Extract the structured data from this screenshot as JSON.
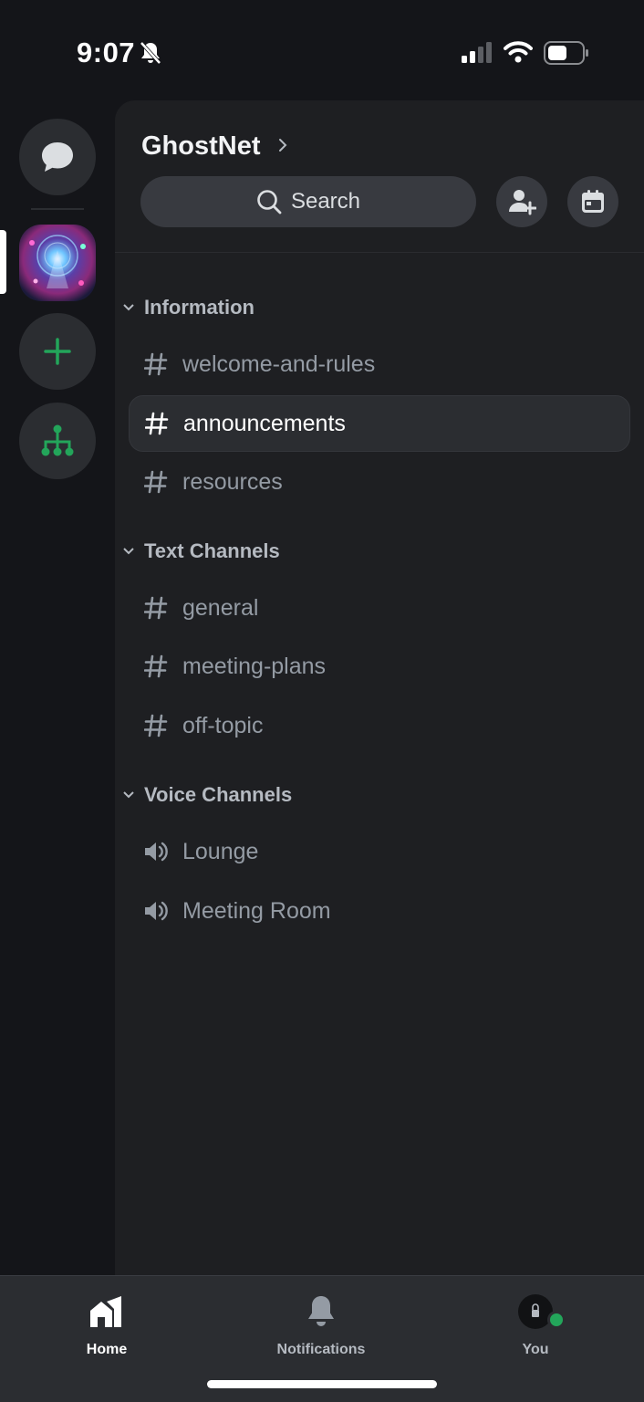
{
  "status_bar": {
    "time": "9:07"
  },
  "server": {
    "name": "GhostNet"
  },
  "search": {
    "label": "Search"
  },
  "categories": [
    {
      "label": "Information",
      "channels": [
        {
          "label": "welcome-and-rules",
          "type": "text"
        },
        {
          "label": "announcements",
          "type": "text",
          "selected": true
        },
        {
          "label": "resources",
          "type": "text"
        }
      ]
    },
    {
      "label": "Text Channels",
      "channels": [
        {
          "label": "general",
          "type": "text"
        },
        {
          "label": "meeting-plans",
          "type": "text"
        },
        {
          "label": "off-topic",
          "type": "text"
        }
      ]
    },
    {
      "label": "Voice Channels",
      "channels": [
        {
          "label": "Lounge",
          "type": "voice"
        },
        {
          "label": "Meeting Room",
          "type": "voice"
        }
      ]
    }
  ],
  "tabs": [
    {
      "label": "Home",
      "icon": "home-icon",
      "active": true
    },
    {
      "label": "Notifications",
      "icon": "bell-icon"
    },
    {
      "label": "You",
      "icon": "avatar"
    }
  ],
  "colors": {
    "background": "#141519",
    "panel": "#1e1f22",
    "accent_green": "#23a55a",
    "selected_row": "#2b2d31"
  }
}
